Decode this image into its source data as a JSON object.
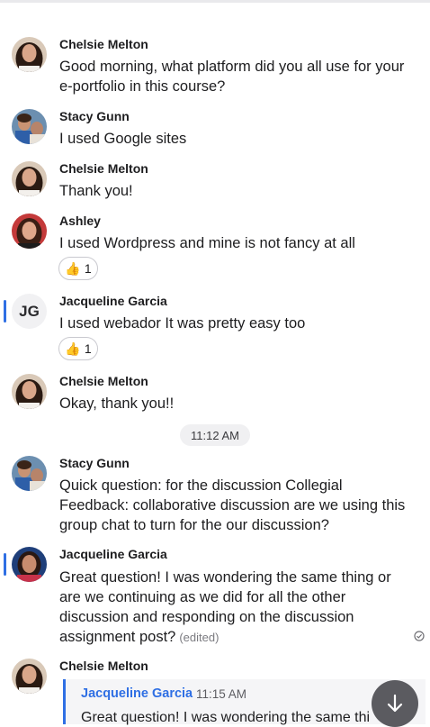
{
  "messages": [
    {
      "sender": "Chelsie Melton",
      "avatar_icon": "chelsie-photo-avatar",
      "lines": [
        "Good morning, what platform did you all use for your",
        "e-portfolio in this course?"
      ]
    },
    {
      "sender": "Stacy Gunn",
      "avatar_icon": "stacy-photo-avatar",
      "lines": [
        "I used Google sites"
      ]
    },
    {
      "sender": "Chelsie Melton",
      "avatar_icon": "chelsie-photo-avatar",
      "lines": [
        "Thank you!"
      ]
    },
    {
      "sender": "Ashley",
      "avatar_icon": "ashley-photo-avatar",
      "lines": [
        "I used Wordpress and mine is not fancy at all"
      ],
      "reaction": {
        "emoji": "👍",
        "count": "1"
      }
    },
    {
      "sender": "Jacqueline Garcia",
      "avatar_initials": "JG",
      "lines": [
        "I used webador It was pretty easy too"
      ],
      "reaction": {
        "emoji": "👍",
        "count": "1"
      }
    },
    {
      "sender": "Chelsie Melton",
      "avatar_icon": "chelsie-photo-avatar",
      "lines": [
        "Okay, thank you!!"
      ]
    },
    {
      "sender": "Stacy Gunn",
      "avatar_icon": "stacy-photo-avatar",
      "lines": [
        "Quick question: for the discussion Collegial",
        "Feedback: collaborative discussion are we using this",
        "group chat to turn for the our discussion?"
      ]
    },
    {
      "sender": "Jacqueline Garcia",
      "avatar_icon": "jacqueline-photo-avatar",
      "lines": [
        "Great question! I was wondering the same thing or",
        "are we continuing as we did for all the other",
        "discussion and responding on the discussion",
        "assignment post?"
      ],
      "edited_label": "(edited)"
    },
    {
      "sender": "Chelsie Melton",
      "avatar_icon": "chelsie-photo-avatar"
    }
  ],
  "time_divider": "11:12 AM",
  "quoted_reply": {
    "sender": "Jacqueline Garcia",
    "time": "11:15 AM",
    "text": "Great question! I was wondering the same thi"
  },
  "colors": {
    "accent": "#2f6fe4",
    "scroll_button": "#5b5b60"
  },
  "icons": {
    "scroll_down": "arrow-down-icon",
    "read_receipt": "check-circle-icon"
  }
}
